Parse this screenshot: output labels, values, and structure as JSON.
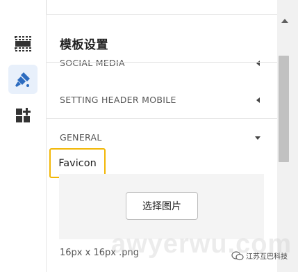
{
  "panel": {
    "title": "模板设置"
  },
  "sections": [
    {
      "label": "SOCIAL MEDIA",
      "state": "collapsed"
    },
    {
      "label": "SETTING HEADER MOBILE",
      "state": "collapsed"
    },
    {
      "label": "GENERAL",
      "state": "expanded"
    }
  ],
  "general": {
    "favicon_label": "Favicon",
    "choose_image_button": "选择图片",
    "size_hint": "16px x 16px .png"
  },
  "rail": {
    "items": [
      {
        "icon": "layout-section-icon",
        "active": false
      },
      {
        "icon": "paint-brush-icon",
        "active": true
      },
      {
        "icon": "add-widgets-icon",
        "active": false
      }
    ]
  },
  "watermark": {
    "text": "awyerwu.com",
    "badge": "江苏互巴科技"
  },
  "colors": {
    "accent": "#2d6cc0",
    "active_bg": "#e8f0fb",
    "highlight_border": "#f2b705",
    "upload_bg": "#f4f4f4"
  }
}
